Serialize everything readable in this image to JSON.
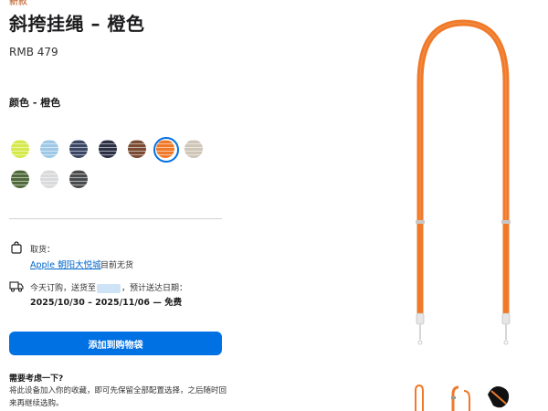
{
  "product": {
    "new_badge": "新款",
    "title": "斜挎挂绳 – 橙色",
    "price": "RMB 479",
    "color_label": "颜色 - 橙色"
  },
  "swatches": [
    {
      "name": "lime",
      "color": "#d6e94a"
    },
    {
      "name": "light-blue",
      "color": "#9ec8e6"
    },
    {
      "name": "navy",
      "color": "#3a4663"
    },
    {
      "name": "dark-navy",
      "color": "#2c3044"
    },
    {
      "name": "brown",
      "color": "#7a4a33"
    },
    {
      "name": "orange",
      "color": "#f07a2a",
      "selected": true
    },
    {
      "name": "beige",
      "color": "#cfc6b8"
    },
    {
      "name": "olive-green",
      "color": "#506a3c"
    },
    {
      "name": "light-gray",
      "color": "#d9dadc"
    },
    {
      "name": "dark-gray",
      "color": "#4a4b4d"
    }
  ],
  "pickup": {
    "label": "取货：",
    "store": "Apple 朝阳大悦城",
    "status": "目前无货"
  },
  "delivery": {
    "prefix": "今天订购，送货至",
    "suffix": "，预计送达日期：",
    "dates": "2025/10/30 – 2025/11/06 — 免费"
  },
  "add_to_bag": "添加到购物袋",
  "consider": {
    "title": "需要考虑一下?",
    "text": "将此设备加入你的收藏，即可先保留全部配置选择，之后随时回来再继续选购。"
  },
  "colors": {
    "accent": "#0071e3",
    "strap": "#f07a2a",
    "link": "#0066cc"
  }
}
